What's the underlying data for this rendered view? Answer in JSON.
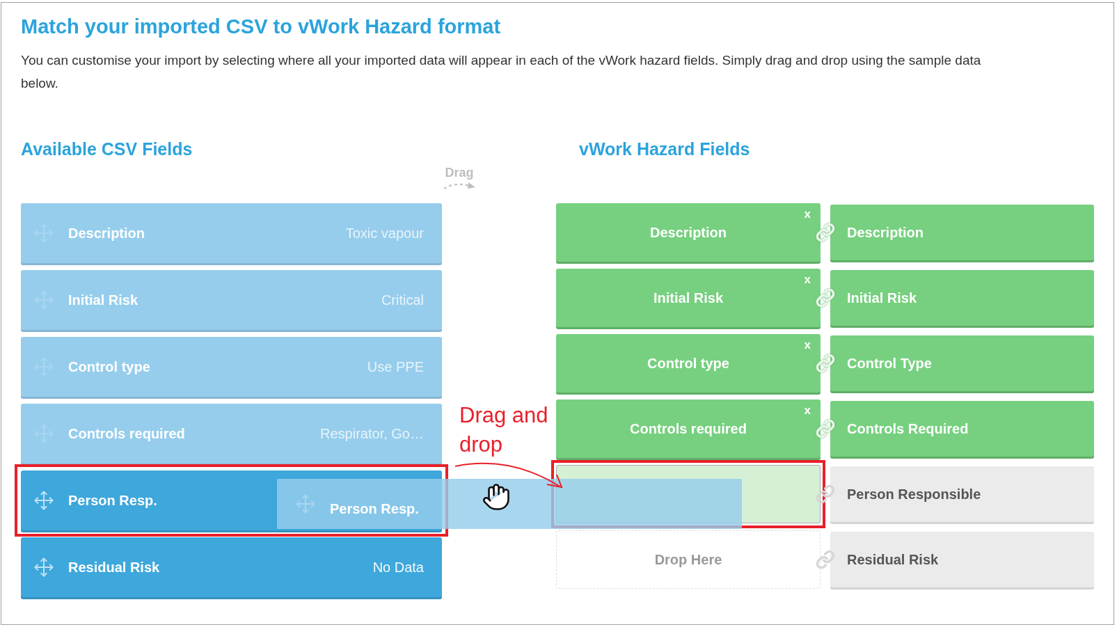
{
  "title": "Match your imported CSV to vWork Hazard format",
  "intro": "You can customise your import by selecting where all your imported data will appear in each of the vWork hazard fields. Simply drag and drop using the sample data below.",
  "csv_heading": "Available CSV Fields",
  "hazard_heading": "vWork Hazard Fields",
  "drag_hint": "Drag",
  "csv_fields": [
    {
      "label": "Description",
      "sample": "Toxic vapour",
      "mapped": true,
      "highlighted": false
    },
    {
      "label": "Initial Risk",
      "sample": "Critical",
      "mapped": true,
      "highlighted": false
    },
    {
      "label": "Control type",
      "sample": "Use PPE",
      "mapped": true,
      "highlighted": false
    },
    {
      "label": "Controls required",
      "sample": "Respirator, Go…",
      "mapped": true,
      "highlighted": false
    },
    {
      "label": "Person Resp.",
      "mapped": false,
      "highlighted": true
    },
    {
      "label": "Residual Risk",
      "sample": "No Data",
      "mapped": false,
      "highlighted": false
    }
  ],
  "hazard_fields": [
    {
      "slot": {
        "kind": "mapped",
        "label": "Description",
        "remove": "x"
      },
      "target": {
        "label": "Description",
        "linked": true
      }
    },
    {
      "slot": {
        "kind": "mapped",
        "label": "Initial Risk",
        "remove": "x"
      },
      "target": {
        "label": "Initial Risk",
        "linked": true
      }
    },
    {
      "slot": {
        "kind": "mapped",
        "label": "Control type",
        "remove": "x"
      },
      "target": {
        "label": "Control Type",
        "linked": true
      }
    },
    {
      "slot": {
        "kind": "mapped",
        "label": "Controls required",
        "remove": "x"
      },
      "target": {
        "label": "Controls Required",
        "linked": true
      }
    },
    {
      "slot": {
        "kind": "drop",
        "highlighted": true
      },
      "target": {
        "label": "Person Responsible",
        "linked": false
      }
    },
    {
      "slot": {
        "kind": "drop",
        "label": "Drop Here",
        "highlighted": false
      },
      "target": {
        "label": "Residual Risk",
        "linked": false
      }
    }
  ],
  "drag_ghost": {
    "label": "Person Resp."
  },
  "annotation": "Drag and drop"
}
